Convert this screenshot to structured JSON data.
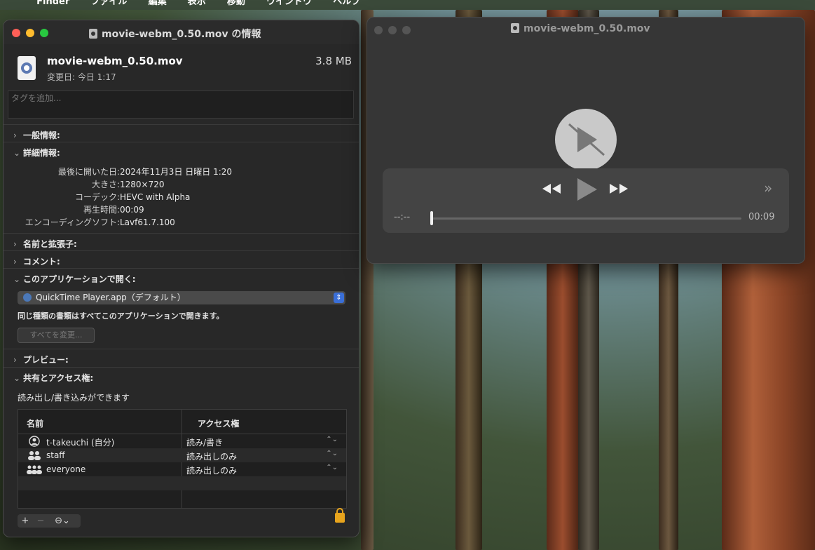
{
  "menubar": {
    "items": [
      "Finder",
      "ファイル",
      "編集",
      "表示",
      "移動",
      "ウインドウ",
      "ヘルプ"
    ]
  },
  "info_window": {
    "title": "movie-webm_0.50.mov の情報",
    "file_name": "movie-webm_0.50.mov",
    "file_size": "3.8 MB",
    "modified": "変更日: 今日 1:17",
    "tags_placeholder": "タグを追加...",
    "sections": {
      "general": "一般情報:",
      "details": "詳細情報:",
      "name_ext": "名前と拡張子:",
      "comments": "コメント:",
      "open_with": "このアプリケーションで開く:",
      "preview": "プレビュー:",
      "sharing": "共有とアクセス権:"
    },
    "details": [
      {
        "key": "最後に開いた日:",
        "value": "2024年11月3日 日曜日 1:20"
      },
      {
        "key": "大きさ:",
        "value": "1280×720"
      },
      {
        "key": "コーデック:",
        "value": "HEVC with Alpha"
      },
      {
        "key": "再生時間:",
        "value": "00:09"
      },
      {
        "key": "エンコーディングソフト:",
        "value": "Lavf61.7.100"
      }
    ],
    "open_with_app": "QuickTime Player.app（デフォルト）",
    "open_with_note": "同じ種類の書類はすべてこのアプリケーションで開きます。",
    "change_all_label": "すべてを変更...",
    "access_note": "読み出し/書き込みができます",
    "perm_headers": {
      "name": "名前",
      "access": "アクセス権"
    },
    "permissions": [
      {
        "name": "t-takeuchi (自分)",
        "access": "読み/書き",
        "icon": "user-icon"
      },
      {
        "name": "staff",
        "access": "読み出しのみ",
        "icon": "group-icon"
      },
      {
        "name": "everyone",
        "access": "読み出しのみ",
        "icon": "everyone-icon"
      }
    ],
    "bottom_buttons": {
      "add": "+",
      "remove": "−",
      "action": "⊖⌄"
    }
  },
  "player_window": {
    "title": "movie-webm_0.50.mov",
    "elapsed": "--:--",
    "duration": "00:09",
    "progress": 0
  }
}
